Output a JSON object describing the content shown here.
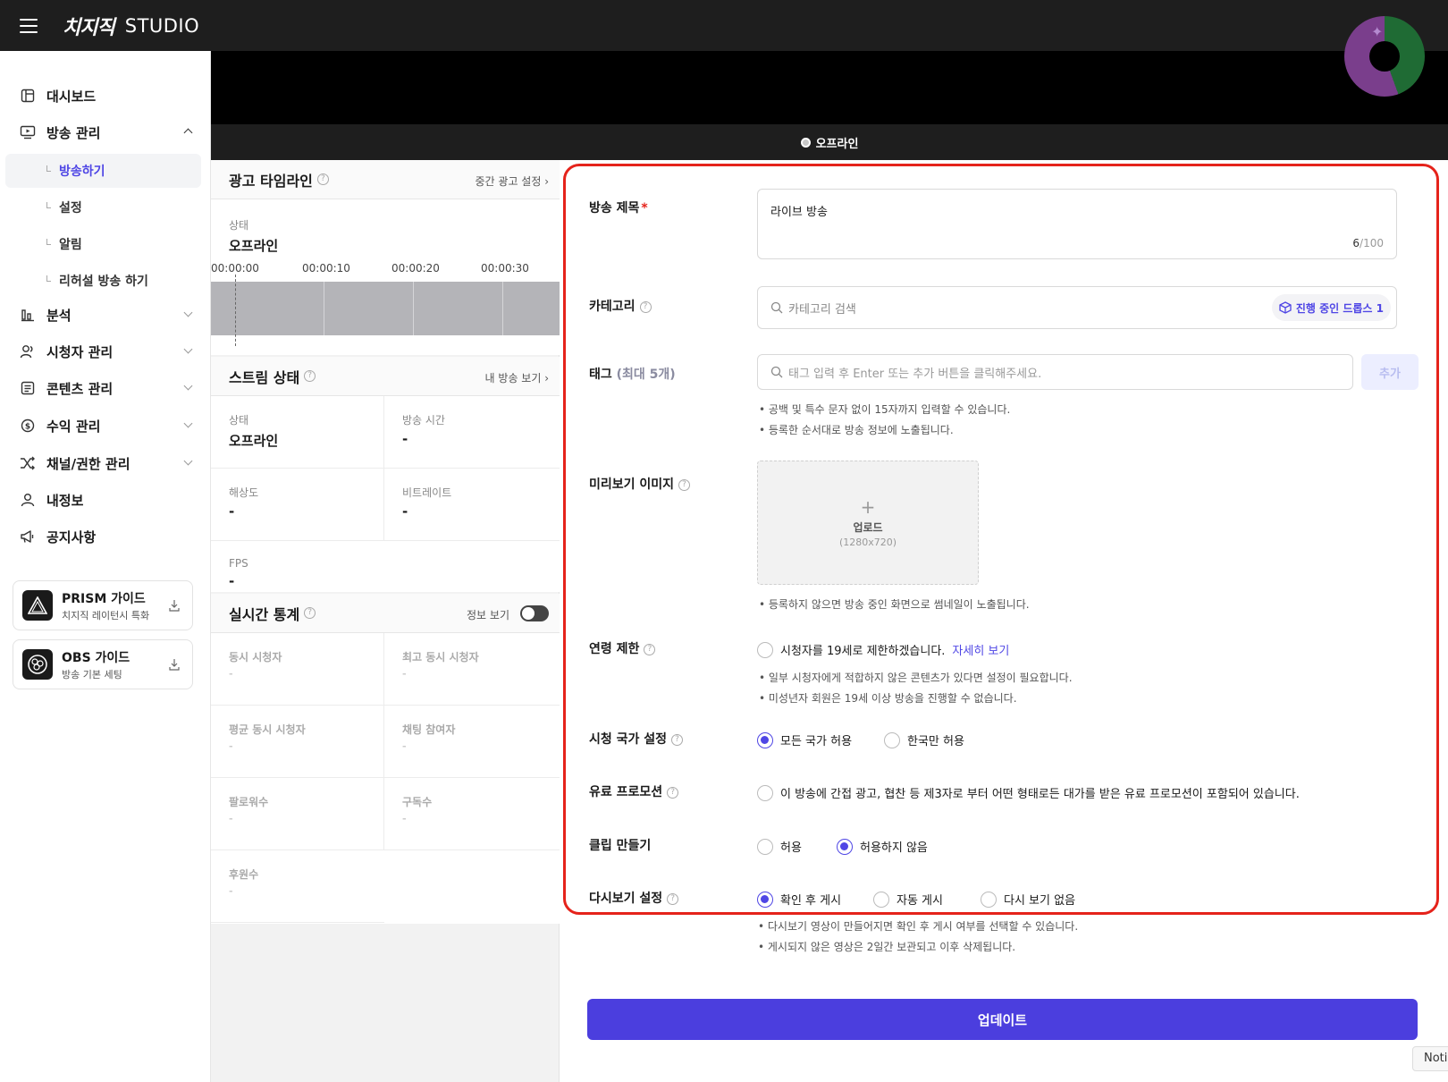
{
  "header": {
    "logo": "치지직",
    "studio": "STUDIO"
  },
  "sidebar": {
    "dashboard": "대시보드",
    "broadcast": "방송 관리",
    "sub": [
      "방송하기",
      "설정",
      "알림",
      "리허설 방송 하기"
    ],
    "analytics": "분석",
    "viewers": "시청자 관리",
    "contents": "콘텐츠 관리",
    "revenue": "수익 관리",
    "channel": "채널/권한 관리",
    "myinfo": "내정보",
    "notice": "공지사항",
    "guides": [
      {
        "title": "PRISM 가이드",
        "sub": "치지직 레이턴시 특화"
      },
      {
        "title": "OBS 가이드",
        "sub": "방송 기본 세팅"
      }
    ]
  },
  "player": {
    "status": "오프라인"
  },
  "ad_timeline": {
    "title": "광고 타임라인",
    "link": "중간 광고 설정 ›",
    "status_label": "상태",
    "status_value": "오프라인",
    "ticks": [
      "00:00:00",
      "00:00:10",
      "00:00:20",
      "00:00:30"
    ]
  },
  "stream_status": {
    "title": "스트림 상태",
    "link": "내 방송 보기 ›",
    "cells": [
      {
        "label": "상태",
        "value": "오프라인"
      },
      {
        "label": "방송 시간",
        "value": "-"
      },
      {
        "label": "해상도",
        "value": "-"
      },
      {
        "label": "비트레이트",
        "value": "-"
      },
      {
        "label": "FPS",
        "value": "-"
      }
    ]
  },
  "realtime": {
    "title": "실시간 통계",
    "toggle_label": "정보 보기",
    "cells": [
      {
        "label": "동시 시청자",
        "value": "-"
      },
      {
        "label": "최고 동시 시청자",
        "value": "-"
      },
      {
        "label": "평균 동시 시청자",
        "value": "-"
      },
      {
        "label": "채팅 참여자",
        "value": "-"
      },
      {
        "label": "팔로워수",
        "value": "-"
      },
      {
        "label": "구독수",
        "value": "-"
      },
      {
        "label": "후원수",
        "value": "-"
      }
    ]
  },
  "form": {
    "title_label": "방송 제목",
    "title_required": "*",
    "title_value": "라이브 방송",
    "title_count": "6",
    "title_max": "/100",
    "category_label": "카테고리",
    "category_placeholder": "카테고리 검색",
    "category_badge": "진행 중인 드롭스 1",
    "tag_label": "태그",
    "tag_label_extra": "(최대 5개)",
    "tag_placeholder": "태그 입력 후 Enter 또는 추가 버튼을 클릭해주세요.",
    "tag_add": "추가",
    "tag_hints": [
      "• 공백 및 특수 문자 없이 15자까지 입력할 수 있습니다.",
      "• 등록한 순서대로 방송 정보에 노출됩니다."
    ],
    "preview_label": "미리보기 이미지",
    "upload_plus": "+",
    "upload_label": "업로드",
    "upload_size": "(1280x720)",
    "preview_hint": "• 등록하지 않으면 방송 중인 화면으로 썸네일이 노출됩니다.",
    "age_label": "연령 제한",
    "age_option": "시청자를 19세로 제한하겠습니다.",
    "age_link": "자세히 보기",
    "age_hints": [
      "• 일부 시청자에게 적합하지 않은 콘텐츠가 있다면 설정이 필요합니다.",
      "• 미성년자 회원은 19세 이상 방송을 진행할 수 없습니다."
    ],
    "country_label": "시청 국가 설정",
    "country_options": [
      "모든 국가 허용",
      "한국만 허용"
    ],
    "promo_label": "유료 프로모션",
    "promo_option": "이 방송에 간접 광고, 협찬 등 제3자로 부터 어떤 형태로든 대가를 받은 유료 프로모션이 포함되어 있습니다.",
    "clip_label": "클립 만들기",
    "clip_options": [
      "허용",
      "허용하지 않음"
    ],
    "replay_label": "다시보기 설정",
    "replay_options": [
      "확인 후 게시",
      "자동 게시",
      "다시 보기 없음"
    ],
    "replay_hints": [
      "• 다시보기 영상이 만들어지면 확인 후 게시 여부를 선택할 수 있습니다.",
      "• 게시되지 않은 영상은 2일간 보관되고 이후 삭제됩니다."
    ],
    "update_button": "업데이트"
  },
  "noti": "Noti"
}
